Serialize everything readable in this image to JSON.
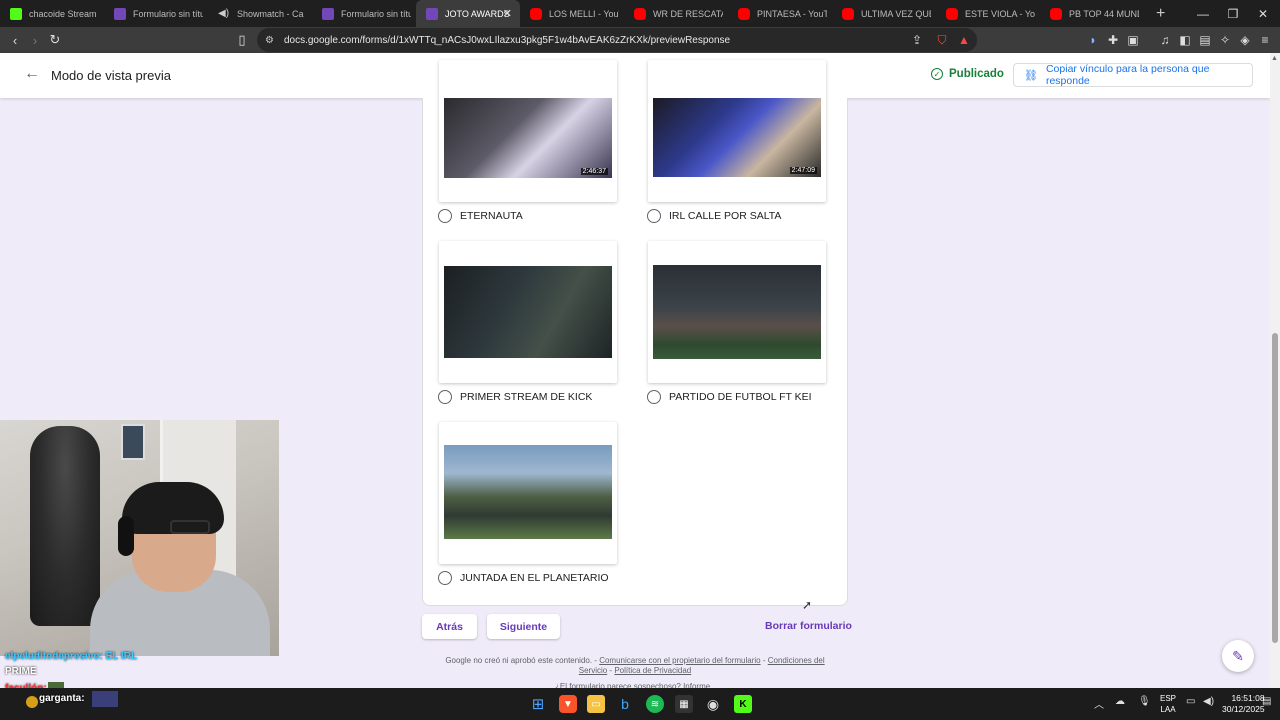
{
  "browser": {
    "tabs": [
      {
        "title": "chacoide Stream",
        "icon": "kick-icon",
        "kind": "kick"
      },
      {
        "title": "Formulario sin título",
        "icon": "google-forms-icon",
        "kind": "forms"
      },
      {
        "title": "Showmatch - Ca",
        "icon": "speaker-icon",
        "kind": "spk"
      },
      {
        "title": "Formulario sin título",
        "icon": "google-forms-icon",
        "kind": "forms"
      },
      {
        "title": "JOTO AWARDS",
        "icon": "google-forms-icon",
        "kind": "forms",
        "active": true
      },
      {
        "title": "LOS MELLI - YouTube",
        "icon": "youtube-icon",
        "kind": "yt"
      },
      {
        "title": "WR DE RESCATAR A",
        "icon": "youtube-icon",
        "kind": "yt"
      },
      {
        "title": "PINTAESA - YouTube",
        "icon": "youtube-icon",
        "kind": "yt"
      },
      {
        "title": "ULTIMA VEZ QUE SI",
        "icon": "youtube-icon",
        "kind": "yt"
      },
      {
        "title": "ESTE VIOLA - YouTube",
        "icon": "youtube-icon",
        "kind": "yt"
      },
      {
        "title": "PB TOP 44 MUNDIA",
        "icon": "youtube-icon",
        "kind": "yt"
      }
    ],
    "url": "docs.google.com/forms/d/1xWTTq_nACsJ0wxLIlazxu3pkg5F1w4bAvEAK6zZrKXk/previewResponse"
  },
  "header": {
    "title": "Modo de vista previa",
    "status": "Publicado",
    "copy_link_label": "Copiar vínculo para la persona que responde"
  },
  "options": [
    {
      "label": "ETERNAUTA",
      "duration": "2:46:37"
    },
    {
      "label": "IRL CALLE POR SALTA",
      "duration": "2:47:09"
    },
    {
      "label": "PRIMER STREAM DE KICK",
      "duration": ""
    },
    {
      "label": "PARTIDO DE FUTBOL FT KEI",
      "duration": ""
    },
    {
      "label": "JUNTADA EN EL PLANETARIO",
      "duration": ""
    }
  ],
  "buttons": {
    "back": "Atrás",
    "next": "Siguiente",
    "clear": "Borrar formulario"
  },
  "footer": {
    "line_start": "Google no creó ni aprobó este contenido. - ",
    "contact": "Comunicarse con el propietario del formulario",
    "sep1": " - ",
    "terms": "Condiciones del Servicio",
    "sep2": " - ",
    "privacy": "Política de Privacidad",
    "report": "¿El formulario parece sospechoso? Informe"
  },
  "overlay": {
    "chat1": "elpeluditodepresivo: EL IRL",
    "chat2": "PRIME",
    "chat3": "facullón:",
    "chat4": "garganta:"
  },
  "taskbar": {
    "lang_top": "ESP",
    "lang_bottom": "LAA",
    "time": "16:51:08",
    "date": "30/12/2025"
  },
  "colors": {
    "accent": "#673ab7",
    "background": "#f0ebf8",
    "published": "#188038",
    "link": "#1a73e8"
  }
}
